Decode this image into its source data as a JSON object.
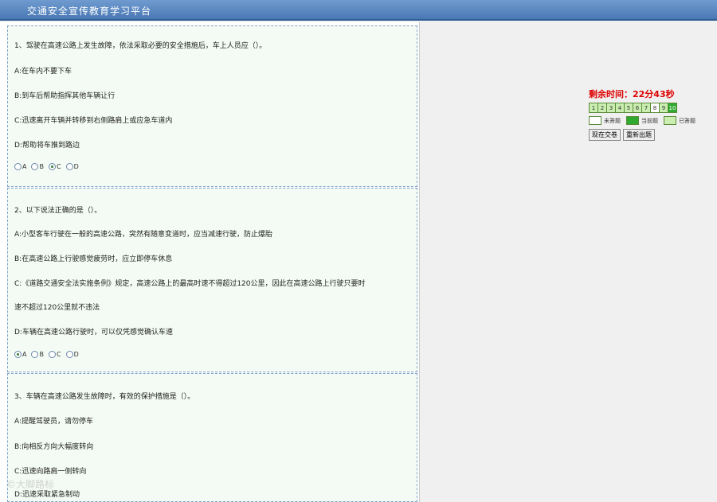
{
  "header": {
    "title": "交通安全宣传教育学习平台"
  },
  "questions": [
    {
      "title": "1、驾驶在高速公路上发生故障，依法采取必要的安全措施后，车上人员应（）。",
      "options": [
        "A:在车内不要下车",
        "B:到车后帮助指挥其他车辆让行",
        "C:迅速离开车辆并转移到右侧路肩上或应急车道内",
        "D:帮助将车推到路边"
      ],
      "radios": [
        "A",
        "B",
        "C",
        "D"
      ],
      "selected": "C"
    },
    {
      "title": "2、以下说法正确的是（）。",
      "options": [
        "A:小型客车行驶在一般的高速公路，突然有随意变道时，应当减速行驶，防止爆胎",
        "B:在高速公路上行驶感觉疲劳时，应立即停车休息",
        "C:《道路交通安全法实施条例》规定，高速公路上的最高时速不得超过120公里，因此在高速公路上行驶只要时",
        "速不超过120公里就不违法",
        "D:车辆在高速公路行驶时，可以仅凭感觉确认车速"
      ],
      "radios": [
        "A",
        "B",
        "C",
        "D"
      ],
      "selected": "A"
    },
    {
      "title": "3、车辆在高速公路发生故障时，有效的保护措施是（）。",
      "options": [
        "A:提醒驾驶员，请勿停车",
        "B:向相反方向大幅度转向",
        "C:迅速向路肩一侧转向",
        "D:迅速采取紧急制动"
      ]
    }
  ],
  "sidebar": {
    "timer": "剩余时间：22分43秒",
    "numbers": [
      "1",
      "2",
      "3",
      "4",
      "5",
      "6",
      "7",
      "8",
      "9",
      "10"
    ],
    "legend": {
      "unanswered": "未答题",
      "current": "当前题",
      "answered": "已答题"
    },
    "submit_label": "现在交卷",
    "restart_label": "重新出题"
  },
  "watermark": "©大脚路标"
}
